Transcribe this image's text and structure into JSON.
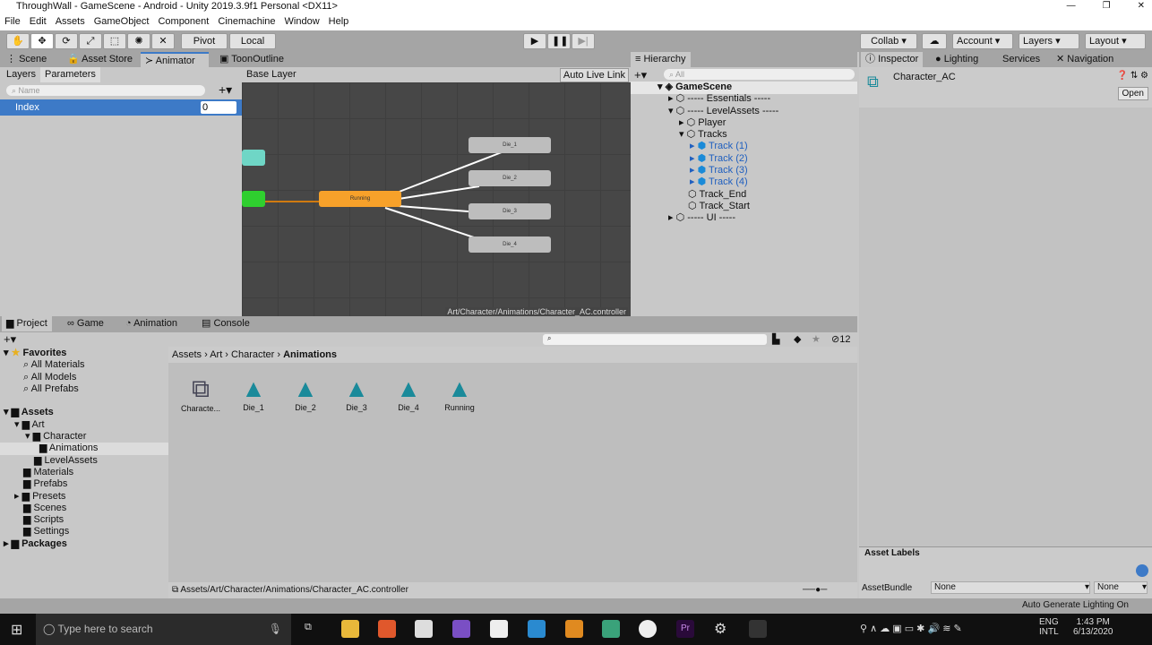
{
  "title": "ThroughWall - GameScene - Android - Unity 2019.3.9f1 Personal <DX11>",
  "window_controls": [
    "—",
    "❐",
    "✕"
  ],
  "menu": [
    "File",
    "Edit",
    "Assets",
    "GameObject",
    "Component",
    "Cinemachine",
    "Window",
    "Help"
  ],
  "toolbar": {
    "pivot": "Pivot",
    "local": "Local",
    "collab": "Collab ▾",
    "account": "Account",
    "layers": "Layers",
    "layout": "Layout"
  },
  "top_tabs": [
    "Scene",
    "Asset Store",
    "Animator",
    "ToonOutline"
  ],
  "animator": {
    "subtabs": [
      "Layers",
      "Parameters"
    ],
    "layer": "Base Layer",
    "live_link": "Auto Live Link",
    "search_placeholder": "Name",
    "params": [
      {
        "name": "Index",
        "value": "0"
      }
    ],
    "nodes": {
      "running": "Running",
      "states": [
        "Die_1",
        "Die_2",
        "Die_3",
        "Die_4"
      ]
    },
    "path": "Art/Character/Animations/Character_AC.controller"
  },
  "hierarchy": {
    "title": "Hierarchy",
    "search_placeholder": "All",
    "items": [
      "GameScene",
      "----- Essentials -----",
      "----- LevelAssets -----",
      "Player",
      "Tracks",
      "Track (1)",
      "Track (2)",
      "Track (3)",
      "Track (4)",
      "Track_End",
      "Track_Start",
      "----- UI -----"
    ]
  },
  "inspector": {
    "tabs": [
      "Inspector",
      "Lighting",
      "Services",
      "Navigation"
    ],
    "asset_name": "Character_AC",
    "open": "Open",
    "asset_labels": "Asset Labels",
    "assetbundle_label": "AssetBundle",
    "bundle": "None",
    "variant": "None"
  },
  "bottom_tabs": [
    "Project",
    "Game",
    "Animation",
    "Console"
  ],
  "project": {
    "hidden_count": "12",
    "favorites": "Favorites",
    "fav_items": [
      "All Materials",
      "All Models",
      "All Prefabs"
    ],
    "assets": "Assets",
    "tree": [
      "Art",
      "Character",
      "Animations",
      "LevelAssets",
      "Materials",
      "Prefabs",
      "Presets",
      "Scenes",
      "Scripts",
      "Settings"
    ],
    "packages": "Packages",
    "breadcrumb": [
      "Assets",
      "Art",
      "Character",
      "Animations"
    ],
    "files": [
      "Characte...",
      "Die_1",
      "Die_2",
      "Die_3",
      "Die_4",
      "Running"
    ],
    "selected_path": "Assets/Art/Character/Animations/Character_AC.controller"
  },
  "status": "Auto Generate Lighting On",
  "taskbar": {
    "search": "Type here to search",
    "lang1": "ENG",
    "lang2": "INTL",
    "time": "1:43 PM",
    "date": "6/13/2020"
  },
  "colors": {
    "running_node": "#f7a12a",
    "entry_node": "#2fcf2f",
    "any_node": "#6fd6c6",
    "selection": "#3d7ac7",
    "track_text": "#1f5fbf",
    "clip_icon": "#1a8a9a"
  }
}
